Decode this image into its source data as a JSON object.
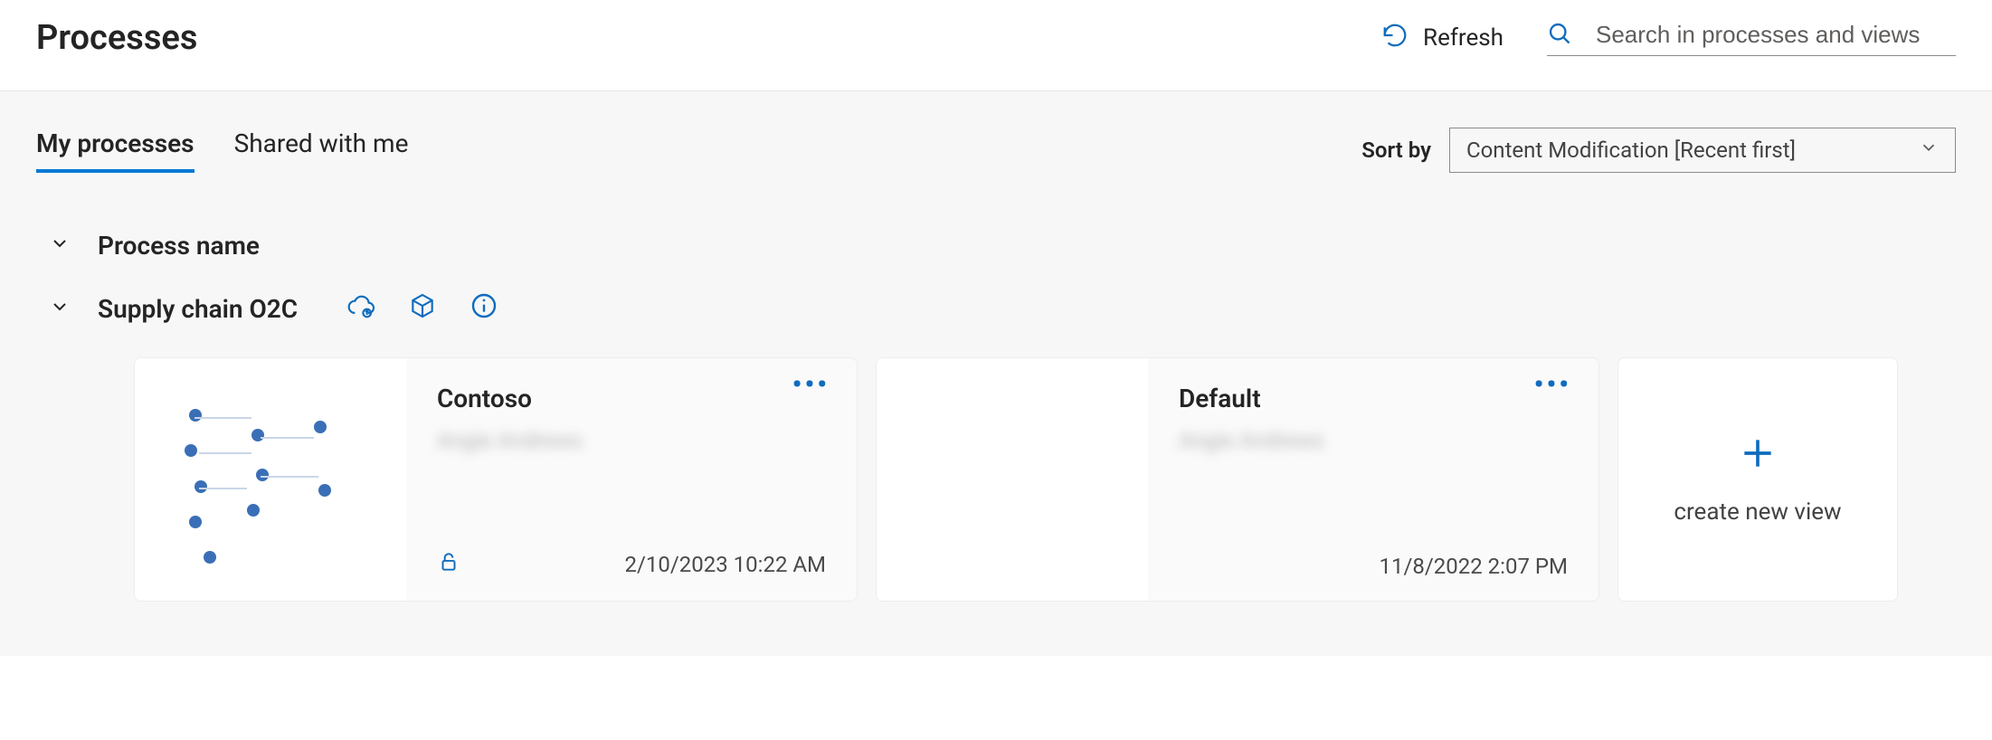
{
  "header": {
    "title": "Processes",
    "refresh_label": "Refresh",
    "search_placeholder": "Search in processes and views"
  },
  "tabs": {
    "my": "My processes",
    "shared": "Shared with me"
  },
  "sort": {
    "label": "Sort by",
    "selected": "Content Modification [Recent first]"
  },
  "group_header": {
    "column_label": "Process name"
  },
  "process": {
    "name": "Supply chain O2C",
    "views": [
      {
        "title": "Contoso",
        "owner": "Angie Andrews",
        "timestamp": "2/10/2023 10:22 AM",
        "locked": true
      },
      {
        "title": "Default",
        "owner": "Angie Andrews",
        "timestamp": "11/8/2022 2:07 PM",
        "locked": false
      }
    ]
  },
  "create_new_label": "create new view",
  "colors": {
    "accent": "#0f6cbd"
  }
}
